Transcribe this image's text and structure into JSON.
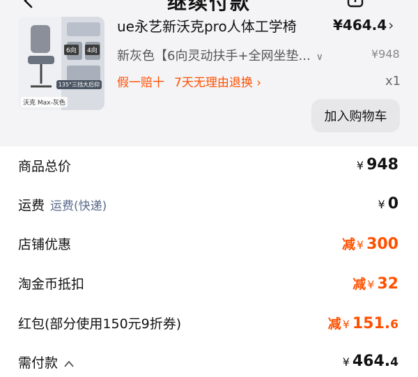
{
  "header": {
    "title": "继续付款"
  },
  "product": {
    "title": "ue永艺新沃克pro人体工学椅",
    "price": "¥464.4",
    "variant": "新灰色【6向灵动扶手+全网坐垫...",
    "original_price": "¥948",
    "promise_1": "假一赔十",
    "promise_2": "7天无理由退换",
    "quantity": "x1",
    "add_to_cart_label": "加入购物车",
    "thumb_label_left": "沃克 Max-灰色",
    "thumb_label_right": "135°三挡大后仰",
    "thumb_tag_a": "6向",
    "thumb_tag_b": "4向"
  },
  "summary": {
    "total_goods": {
      "label": "商品总价",
      "currency": "¥",
      "value": "948"
    },
    "shipping": {
      "label": "运费",
      "sub": "运费(快递)",
      "currency": "¥",
      "value": "0"
    },
    "store_discount": {
      "label": "店铺优惠",
      "prefix": "减",
      "currency": "¥",
      "value": "300"
    },
    "coin_deduction": {
      "label": "淘金币抵扣",
      "prefix": "减",
      "currency": "¥",
      "value": "32"
    },
    "red_packet": {
      "label": "红包(部分使用150元9折券)",
      "prefix": "减",
      "currency": "¥",
      "value_int": "151.",
      "value_dec": "6"
    },
    "payable": {
      "label": "需付款",
      "currency": "¥",
      "value_int": "464.",
      "value_dec": "4"
    }
  },
  "colors": {
    "accent": "#ff5000",
    "text": "#111111",
    "muted": "#888888"
  }
}
